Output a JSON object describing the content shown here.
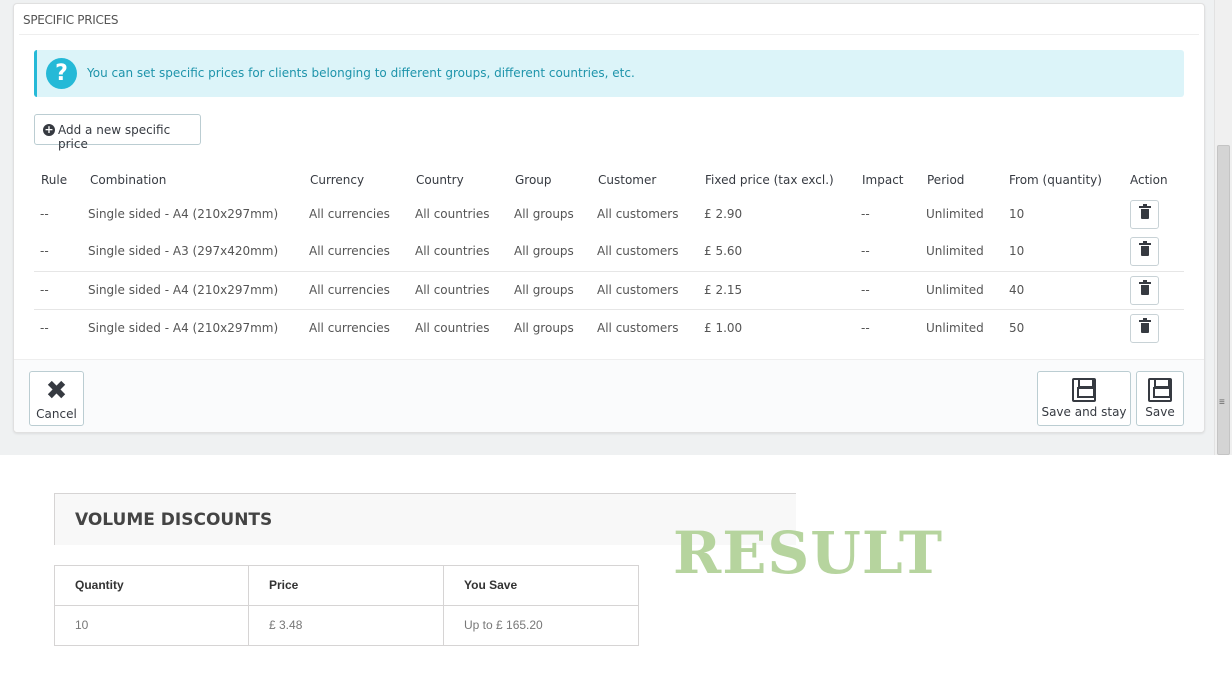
{
  "specific_prices": {
    "heading": "SPECIFIC PRICES",
    "alert": "You can set specific prices for clients belonging to different groups, different countries, etc.",
    "add_button": "Add a new specific price",
    "columns": [
      "Rule",
      "Combination",
      "Currency",
      "Country",
      "Group",
      "Customer",
      "Fixed price (tax excl.)",
      "Impact",
      "Period",
      "From (quantity)",
      "Action"
    ],
    "rows": [
      {
        "rule": "--",
        "combination": "Single sided - A4 (210x297mm)",
        "currency": "All currencies",
        "country": "All countries",
        "group": "All groups",
        "customer": "All customers",
        "price": "£ 2.90",
        "impact": "--",
        "period": "Unlimited",
        "from": "10"
      },
      {
        "rule": "--",
        "combination": "Single sided - A3 (297x420mm)",
        "currency": "All currencies",
        "country": "All countries",
        "group": "All groups",
        "customer": "All customers",
        "price": "£ 5.60",
        "impact": "--",
        "period": "Unlimited",
        "from": "10"
      },
      {
        "rule": "--",
        "combination": "Single sided - A4 (210x297mm)",
        "currency": "All currencies",
        "country": "All countries",
        "group": "All groups",
        "customer": "All customers",
        "price": "£ 2.15",
        "impact": "--",
        "period": "Unlimited",
        "from": "40"
      },
      {
        "rule": "--",
        "combination": "Single sided - A4 (210x297mm)",
        "currency": "All currencies",
        "country": "All countries",
        "group": "All groups",
        "customer": "All customers",
        "price": "£ 1.00",
        "impact": "--",
        "period": "Unlimited",
        "from": "50"
      }
    ],
    "footer": {
      "cancel": "Cancel",
      "save_and_stay": "Save and stay",
      "save": "Save"
    }
  },
  "volume_discounts": {
    "title": "VOLUME DISCOUNTS",
    "columns": [
      "Quantity",
      "Price",
      "You Save"
    ],
    "rows": [
      {
        "quantity": "10",
        "price": "£ 3.48",
        "you_save": "Up to £ 165.20"
      }
    ]
  },
  "overlay_text": "RESULT",
  "colors": {
    "info_bg": "#dcf4f9",
    "info_accent": "#25b9d7",
    "result_text": "#b6d49e"
  }
}
